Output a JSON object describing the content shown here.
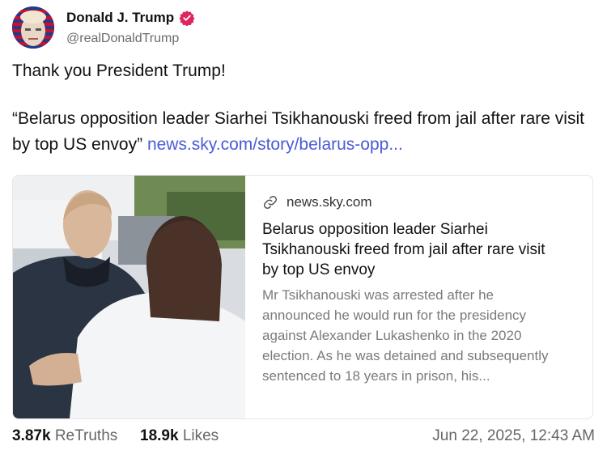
{
  "post": {
    "display_name": "Donald J. Trump",
    "handle": "@realDonaldTrump",
    "verified": true,
    "verified_color": "#e0245e",
    "line1": "Thank you President Trump!",
    "quote_text": "“Belarus opposition leader Siarhei Tsikhanouski freed from jail after rare visit by top US envoy”",
    "link_text": "news.sky.com/story/belarus-opp...",
    "link_color": "#4a5bd6"
  },
  "card": {
    "icon": "link-icon",
    "domain": "news.sky.com",
    "title": "Belarus opposition leader Siarhei Tsikhanouski freed from jail after rare visit by top US envoy",
    "description": "Mr Tsikhanouski was arrested after he announced he would run for the presidency against Alexander Lukashenko in the 2020 election. As he was detained and subsequently sentenced to 18 years in prison, his..."
  },
  "footer": {
    "retruths_count": "3.87k",
    "retruths_label": "ReTruths",
    "likes_count": "18.9k",
    "likes_label": "Likes",
    "timestamp": "Jun 22, 2025, 12:43 AM"
  }
}
